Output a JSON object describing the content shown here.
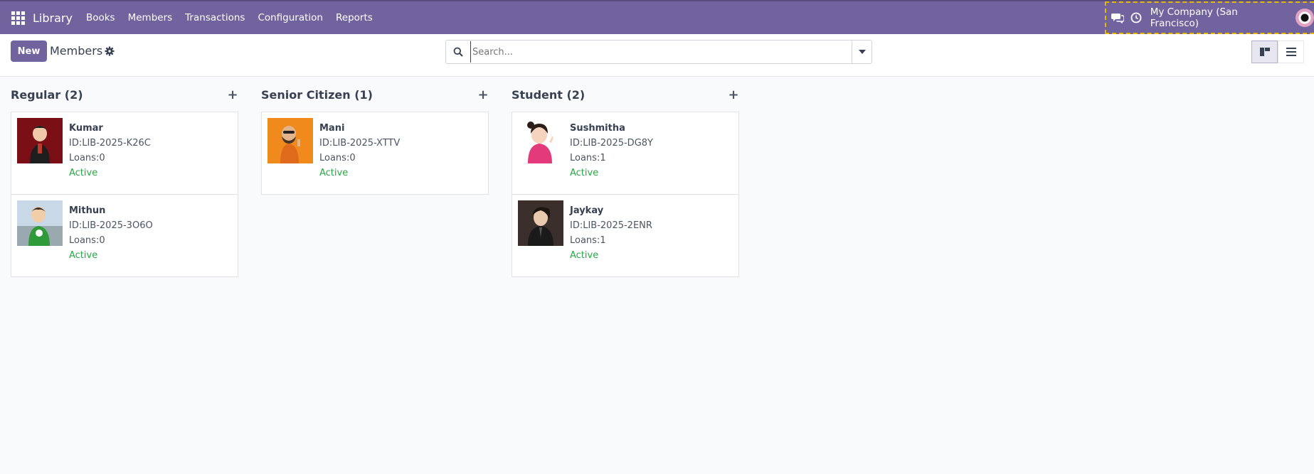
{
  "navbar": {
    "brand": "Library",
    "menu": [
      "Books",
      "Members",
      "Transactions",
      "Configuration",
      "Reports"
    ],
    "company": "My Company (San Francisco)"
  },
  "control": {
    "new_label": "New",
    "title": "Members",
    "search_placeholder": "Search..."
  },
  "columns": [
    {
      "title": "Regular (2)",
      "cards": [
        {
          "name": "Kumar",
          "id": "ID:LIB-2025-K26C",
          "loans": "Loans:0",
          "status": "Active"
        },
        {
          "name": "Mithun",
          "id": "ID:LIB-2025-3O6O",
          "loans": "Loans:0",
          "status": "Active"
        }
      ]
    },
    {
      "title": "Senior Citizen (1)",
      "cards": [
        {
          "name": "Mani",
          "id": "ID:LIB-2025-XTTV",
          "loans": "Loans:0",
          "status": "Active"
        }
      ]
    },
    {
      "title": "Student (2)",
      "cards": [
        {
          "name": "Sushmitha",
          "id": "ID:LIB-2025-DG8Y",
          "loans": "Loans:1",
          "status": "Active"
        },
        {
          "name": "Jaykay",
          "id": "ID:LIB-2025-2ENR",
          "loans": "Loans:1",
          "status": "Active"
        }
      ]
    }
  ],
  "colors": {
    "brand": "#71639e",
    "active_status": "#28a745"
  }
}
